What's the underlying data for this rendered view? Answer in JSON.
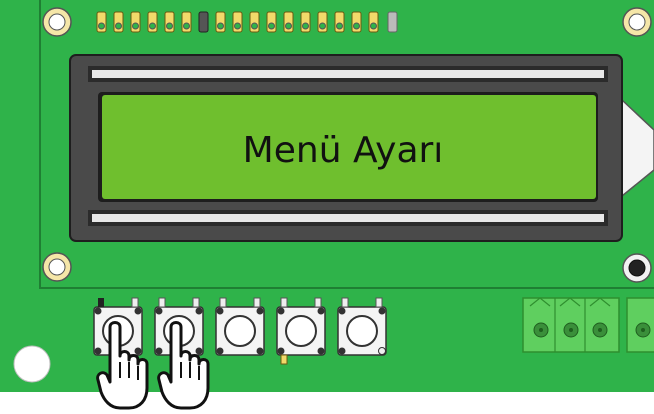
{
  "display": {
    "text": "Menü Ayarı"
  },
  "buttons": [
    {
      "name": "button-1",
      "pressed": true
    },
    {
      "name": "button-2",
      "pressed": true
    },
    {
      "name": "button-3",
      "pressed": false
    },
    {
      "name": "button-4",
      "pressed": false
    },
    {
      "name": "button-5",
      "pressed": false
    }
  ],
  "colors": {
    "pcb": "#2fb34a",
    "pcb_border": "#1f7f33",
    "lcd_bezel": "#4a4a4a",
    "lcd_screen": "#6fbf2e",
    "pins": "#f2d96a",
    "pin_dark": "#555555",
    "terminal": "#5fcf5f"
  },
  "icons": [
    "hand-pointer-icon",
    "mounting-hole-icon",
    "tactile-button-icon",
    "terminal-block-icon"
  ]
}
